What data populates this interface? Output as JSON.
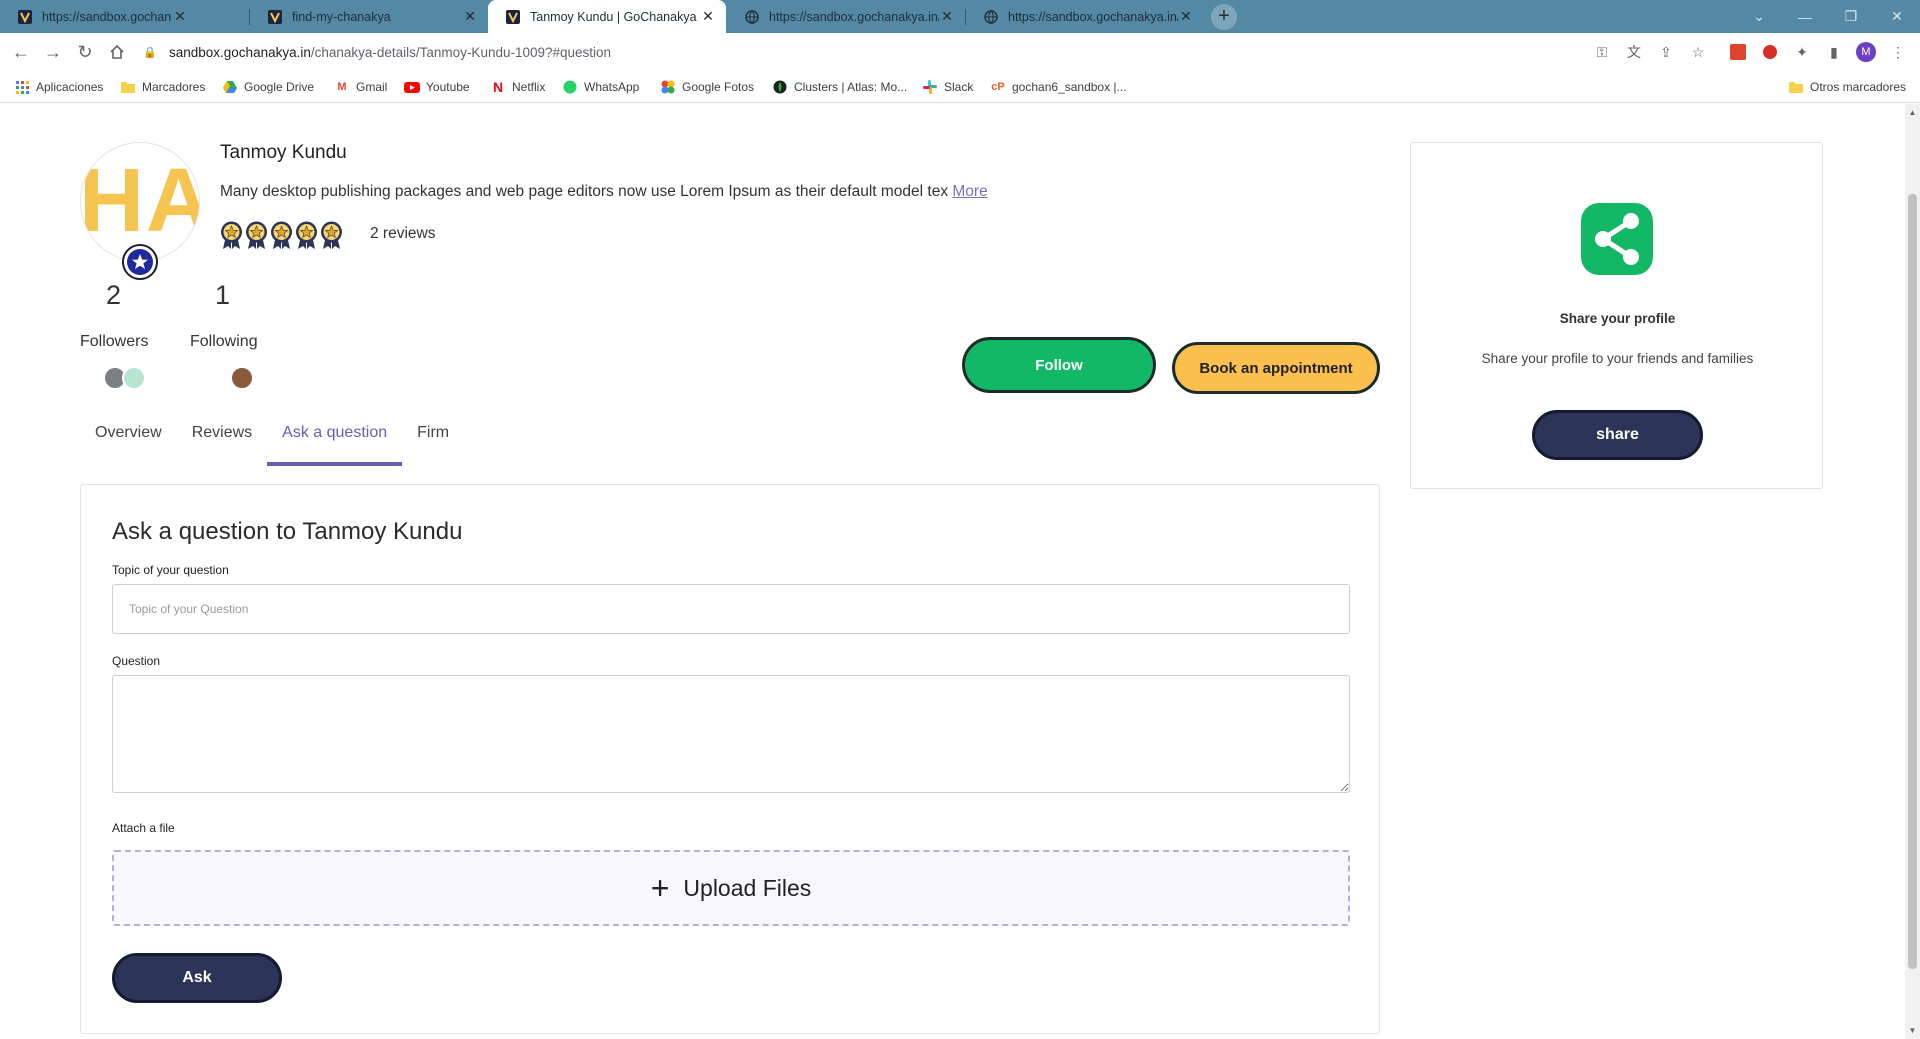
{
  "browser": {
    "tabs": [
      {
        "title": "https://sandbox.gochanakya.in/m"
      },
      {
        "title": "find-my-chanakya"
      },
      {
        "title": "Tanmoy Kundu | GoChanakya"
      },
      {
        "title": "https://sandbox.gochanakya.in/q"
      },
      {
        "title": "https://sandbox.gochanakya.in/p"
      }
    ],
    "url_host": "sandbox.gochanakya.in",
    "url_path": "/chanakya-details/Tanmoy-Kundu-1009?#question",
    "profile_initial": "M",
    "bookmarks": [
      {
        "label": "Aplicaciones"
      },
      {
        "label": "Marcadores"
      },
      {
        "label": "Google Drive"
      },
      {
        "label": "Gmail"
      },
      {
        "label": "Youtube"
      },
      {
        "label": "Netflix"
      },
      {
        "label": "WhatsApp"
      },
      {
        "label": "Google Fotos"
      },
      {
        "label": "Clusters | Atlas: Mo..."
      },
      {
        "label": "Slack"
      },
      {
        "label": "gochan6_sandbox |..."
      }
    ],
    "other_bookmarks": "Otros marcadores"
  },
  "profile": {
    "avatar_initials": "HA",
    "name": "Tanmoy Kundu",
    "bio": "Many desktop publishing packages and web page editors now use Lorem Ipsum as their default model tex",
    "more_link": "More",
    "rating": 5,
    "reviews_label": "2 reviews",
    "followers_count": "2",
    "followers_label": "Followers",
    "following_count": "1",
    "following_label": "Following",
    "follow_button": "Follow",
    "book_button": "Book an appointment"
  },
  "tabs": [
    {
      "label": "Overview"
    },
    {
      "label": "Reviews"
    },
    {
      "label": "Ask a question"
    },
    {
      "label": "Firm"
    }
  ],
  "form": {
    "title": "Ask a question to Tanmoy Kundu",
    "topic_label": "Topic of your question",
    "topic_placeholder": "Topic of your Question",
    "question_label": "Question",
    "attach_label": "Attach a file",
    "upload_label": "Upload Files",
    "ask_button": "Ask"
  },
  "share": {
    "title": "Share your profile",
    "subtitle": "Share your profile to your friends and families",
    "button": "share"
  },
  "colors": {
    "tabbar": "#5389a5",
    "accent_purple": "#6e5ab3",
    "follow_green": "#12b865",
    "book_yellow": "#fcc04f",
    "navy": "#2c3457"
  }
}
